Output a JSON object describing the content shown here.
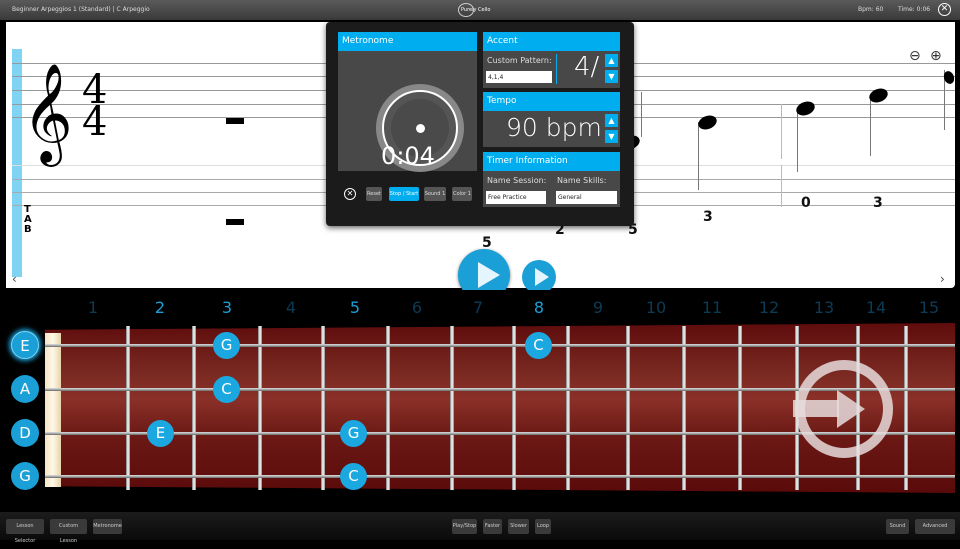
{
  "titlebar": {
    "lesson": "Beginner Arpeggios 1 (Standard)  |  C Arpeggio",
    "logo_text": "Purely Cello",
    "bpm": "Bpm: 60",
    "time": "Time: 0:06",
    "close_glyph": "✕"
  },
  "score": {
    "clef_glyph": "𝄞",
    "time_sig_top": "4",
    "time_sig_bottom": "4",
    "tab_label": [
      "T",
      "A",
      "B"
    ],
    "tab_numbers": [
      "5",
      "2",
      "5",
      "3",
      "0",
      "3"
    ],
    "zoom_out_glyph": "⊖",
    "zoom_in_glyph": "⊕",
    "scroll_left_glyph": "‹",
    "scroll_right_glyph": "›"
  },
  "metronome": {
    "title": "Metronome",
    "timer": "0:04",
    "close_glyph": "✕",
    "buttons": [
      "Reset",
      "Stop / Start",
      "Sound 1",
      "Color 1"
    ],
    "accent": {
      "title": "Accent",
      "custom_pattern_label": "Custom Pattern:",
      "custom_pattern_value": "4,1,4",
      "beats_display": "4/"
    },
    "tempo": {
      "title": "Tempo",
      "value": "90 bpm"
    },
    "timer_info": {
      "title": "Timer Information",
      "session_label": "Name Session:",
      "session_value": "Free Practice",
      "skills_label": "Name Skills:",
      "skills_value": "General"
    },
    "up_glyph": "▲",
    "down_glyph": "▼"
  },
  "fretboard": {
    "fret_numbers": [
      "1",
      "2",
      "3",
      "4",
      "5",
      "6",
      "7",
      "8",
      "9",
      "10",
      "11",
      "12",
      "13",
      "14",
      "15"
    ],
    "highlighted_frets": [
      "2",
      "3",
      "5",
      "8"
    ],
    "open_strings": [
      "E",
      "A",
      "D",
      "G"
    ],
    "notes": [
      {
        "string": "E",
        "fret": "3",
        "label": "G"
      },
      {
        "string": "E",
        "fret": "8",
        "label": "C"
      },
      {
        "string": "A",
        "fret": "3",
        "label": "C"
      },
      {
        "string": "D",
        "fret": "2",
        "label": "E"
      },
      {
        "string": "D",
        "fret": "5",
        "label": "G"
      },
      {
        "string": "G",
        "fret": "5",
        "label": "C"
      }
    ]
  },
  "bottombar": {
    "left": [
      "Lesson Selector",
      "Custom Lesson",
      "Metronome"
    ],
    "center": [
      "Play/Stop",
      "Faster",
      "Slower",
      "Loop"
    ],
    "right": [
      "Sound",
      "Advanced"
    ]
  },
  "colors": {
    "accent": "#00aeef",
    "note_blue": "#1a9fd6",
    "fretboard": "#6d1a16"
  }
}
